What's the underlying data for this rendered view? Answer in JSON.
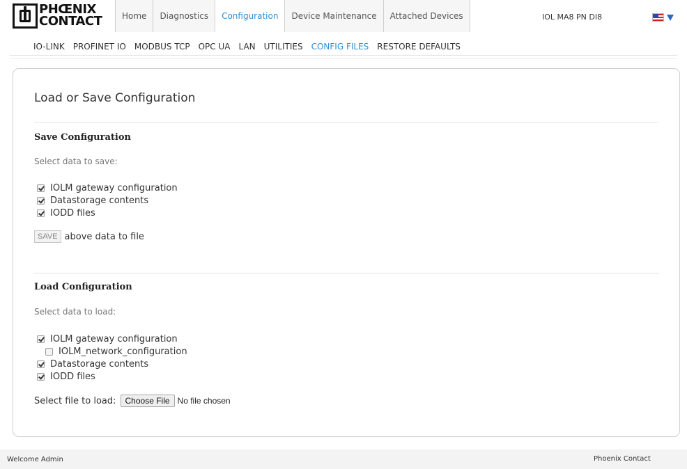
{
  "header": {
    "logo_line1": "PHŒNIX",
    "logo_line2": "CONTACT",
    "device_name": "IOL MA8 PN DI8",
    "main_tabs": [
      {
        "label": "Home"
      },
      {
        "label": "Diagnostics"
      },
      {
        "label": "Configuration",
        "active": true
      },
      {
        "label": "Device Maintenance"
      },
      {
        "label": "Attached Devices"
      }
    ],
    "language_icon": "us-flag-icon"
  },
  "subnav": {
    "items": [
      {
        "label": "IO-LINK"
      },
      {
        "label": "PROFINET IO"
      },
      {
        "label": "MODBUS TCP"
      },
      {
        "label": "OPC UA"
      },
      {
        "label": "LAN"
      },
      {
        "label": "UTILITIES"
      },
      {
        "label": "CONFIG FILES",
        "active": true
      },
      {
        "label": "RESTORE DEFAULTS"
      }
    ]
  },
  "panel": {
    "title": "Load or Save Configuration",
    "save": {
      "title": "Save Configuration",
      "hint": "Select data to save:",
      "options": [
        {
          "label": "IOLM gateway configuration",
          "checked": true
        },
        {
          "label": "Datastorage contents",
          "checked": true
        },
        {
          "label": "IODD files",
          "checked": true
        }
      ],
      "button_label": "SAVE",
      "button_suffix": "above data to file"
    },
    "load": {
      "title": "Load Configuration",
      "hint": "Select data to load:",
      "options": [
        {
          "label": "IOLM gateway configuration",
          "checked": true
        },
        {
          "label": "IOLM_network_configuration",
          "checked": false
        },
        {
          "label": "Datastorage contents",
          "checked": true
        },
        {
          "label": "IODD files",
          "checked": true
        }
      ],
      "file_label": "Select file to load:",
      "choose_button": "Choose File",
      "file_status": "No file chosen"
    }
  },
  "footer": {
    "welcome": "Welcome Admin",
    "brand": "Phoenix Contact"
  },
  "colors": {
    "accent": "#2f8fd0",
    "panel_border": "#cfcfcf",
    "footer_bg": "#f3f3f3"
  }
}
